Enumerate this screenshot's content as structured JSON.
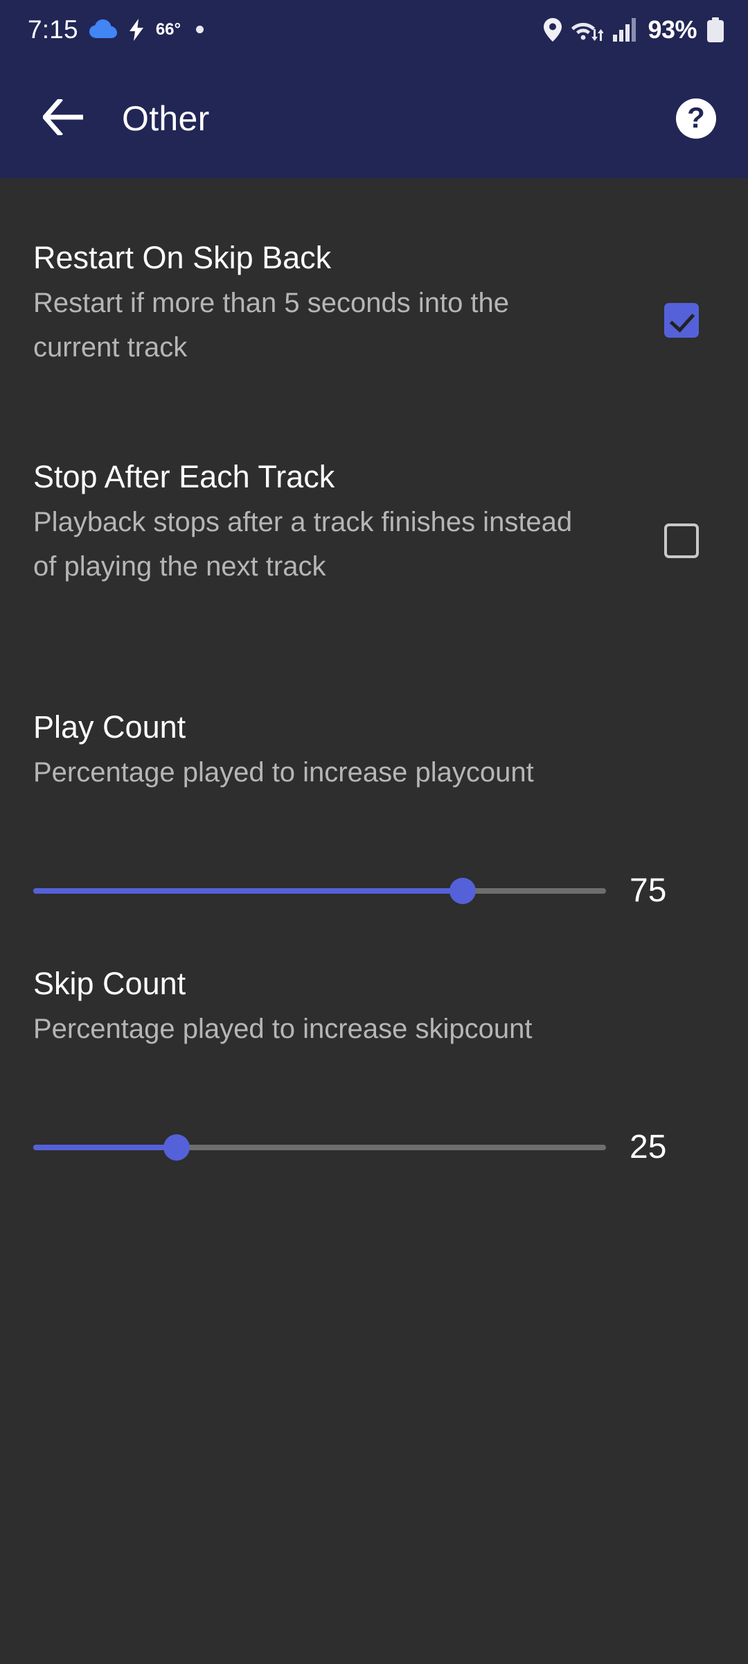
{
  "status_bar": {
    "time": "7:15",
    "temperature": "66°",
    "battery_percent": "93%",
    "icons": [
      "cloud-icon",
      "bolt-icon",
      "notification-dot-icon",
      "location-pin-icon",
      "wifi-icon",
      "signal-bars-icon",
      "battery-icon"
    ],
    "cloud_color": "#4285f4"
  },
  "app_bar": {
    "title": "Other",
    "back_icon": "back-arrow-icon",
    "help_icon": "help-question-icon",
    "background": "#222655"
  },
  "theme": {
    "background": "#2e2e2e",
    "accent": "#5561d8",
    "title_color": "#ffffff",
    "summary_color": "#b6b6b6",
    "checkbox_outline": "#c9c9c9",
    "slider_track": "#6e6e6e"
  },
  "preferences": [
    {
      "key": "restart_on_skip_back",
      "title": "Restart On Skip Back",
      "summary": "Restart if more than 5 seconds into the current track",
      "type": "checkbox",
      "checked": true
    },
    {
      "key": "stop_after_each_track",
      "title": "Stop After Each Track",
      "summary": "Playback stops after a track finishes instead of playing the next track",
      "type": "checkbox",
      "checked": false
    },
    {
      "key": "play_count",
      "title": "Play Count",
      "summary": "Percentage played to increase playcount",
      "type": "slider",
      "value": 75,
      "value_label": "75",
      "min": 0,
      "max": 100
    },
    {
      "key": "skip_count",
      "title": "Skip Count",
      "summary": "Percentage played to increase skipcount",
      "type": "slider",
      "value": 25,
      "value_label": "25",
      "min": 0,
      "max": 100
    }
  ]
}
